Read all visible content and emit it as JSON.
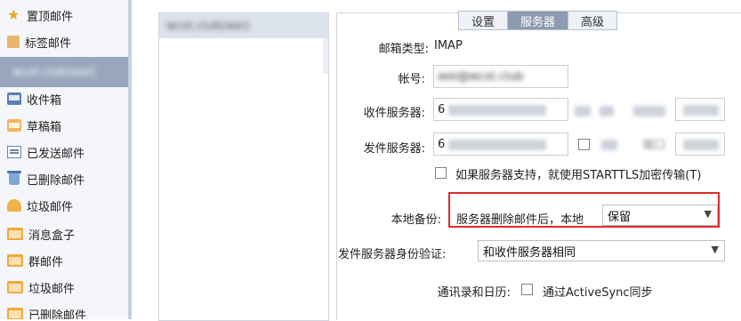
{
  "sidebar": {
    "items": [
      {
        "label": "置顶邮件",
        "icon": "star-icon"
      },
      {
        "label": "标签邮件",
        "icon": "tag-icon"
      },
      {
        "label": "wcst.club(wei)",
        "icon": "account-icon"
      },
      {
        "label": "收件箱",
        "icon": "inbox-icon"
      },
      {
        "label": "草稿箱",
        "icon": "draft-icon"
      },
      {
        "label": "已发送邮件",
        "icon": "sent-icon"
      },
      {
        "label": "已删除邮件",
        "icon": "trash-icon"
      },
      {
        "label": "垃圾邮件",
        "icon": "spam-icon"
      },
      {
        "label": "消息盒子",
        "icon": "folder-icon"
      },
      {
        "label": "群邮件",
        "icon": "folder-icon"
      },
      {
        "label": "垃圾邮件",
        "icon": "folder-icon"
      },
      {
        "label": "已删除邮件",
        "icon": "folder-icon"
      }
    ]
  },
  "tabs": [
    {
      "label": "设置",
      "active": false
    },
    {
      "label": "服务器",
      "active": true
    },
    {
      "label": "高级",
      "active": false
    }
  ],
  "form": {
    "mail_type_label": "邮箱类型:",
    "mail_type_value": "IMAP",
    "account_label": "帐号:",
    "account_value": "wei@wcst.club",
    "incoming_label": "收件服务器:",
    "incoming_value": "6",
    "outgoing_label": "发件服务器:",
    "outgoing_value": "6",
    "port_label": "端口",
    "starttls_label": "如果服务器支持，就使用STARTTLS加密传输(T)",
    "backup_label": "本地备份:",
    "backup_desc": "服务器删除邮件后，本地",
    "backup_value": "保留",
    "auth_label": "发件服务器身份验证:",
    "auth_value": "和收件服务器相同",
    "contacts_label": "通讯录和日历:",
    "activesync_label": "通过ActiveSync同步"
  },
  "colors": {
    "highlight": "#e02b2b",
    "active_tab": "#8d9bb0",
    "selected_account": "#99a6bd"
  }
}
